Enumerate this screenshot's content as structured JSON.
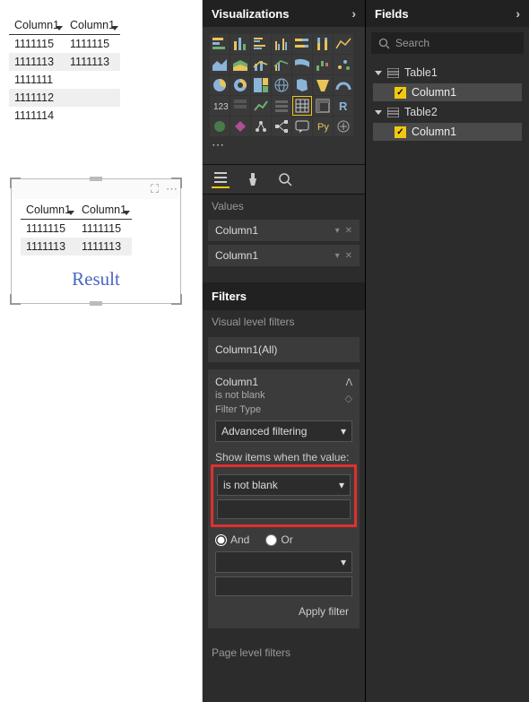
{
  "canvas": {
    "table1": {
      "headers": [
        "Column1",
        "Column1"
      ],
      "rows": [
        [
          "1111115",
          "1111115"
        ],
        [
          "1111113",
          "1111113"
        ],
        [
          "1111111",
          ""
        ],
        [
          "1111112",
          ""
        ],
        [
          "1111114",
          ""
        ]
      ]
    },
    "table2": {
      "headers": [
        "Column1",
        "Column1"
      ],
      "rows": [
        [
          "1111115",
          "1111115"
        ],
        [
          "1111113",
          "1111113"
        ]
      ]
    },
    "result_label": "Result"
  },
  "viz": {
    "title": "Visualizations",
    "values_label": "Values",
    "value_wells": [
      "Column1",
      "Column1"
    ],
    "filters_title": "Filters",
    "visual_filters_label": "Visual level filters",
    "filter_all": "Column1(All)",
    "filter_card": {
      "field": "Column1",
      "summary": "is not blank",
      "type_label": "Filter Type",
      "type_value": "Advanced filtering",
      "show_label": "Show items when the value:",
      "condition": "is not blank",
      "and_label": "And",
      "or_label": "Or",
      "apply": "Apply filter"
    },
    "page_filters_label": "Page level filters"
  },
  "fields": {
    "title": "Fields",
    "search_placeholder": "Search",
    "tables": [
      {
        "name": "Table1",
        "cols": [
          "Column1"
        ]
      },
      {
        "name": "Table2",
        "cols": [
          "Column1"
        ]
      }
    ]
  }
}
